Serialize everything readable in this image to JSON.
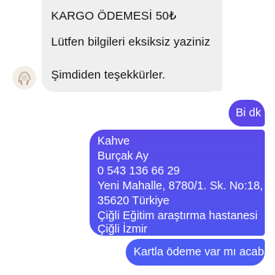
{
  "incoming": {
    "line1": "KARGO ÖDEMESİ 50₺",
    "line2": "Lütfen bilgileri eksiksiz yaziniz",
    "line3": "Şimdiden teşekkürler."
  },
  "outgoing": {
    "short": "Bi dk",
    "address_lines": [
      "Kahve",
      "Burçak Ay",
      "0 543 136 66 29",
      "Yeni Mahalle, 8780/1. Sk. No:18,",
      "35620 Türkiye",
      "Çiğli Eğitim araştırma hastanesi",
      "Çiğli İzmir"
    ],
    "last": "Kartla ödeme var mı acaba"
  },
  "colors": {
    "incoming_bubble": "#efefef",
    "outgoing_bubble": "#5c46e8",
    "outgoing_bubble_alt": "#4a5cf2"
  },
  "icons": {
    "avatar": "user-avatar-icon"
  }
}
